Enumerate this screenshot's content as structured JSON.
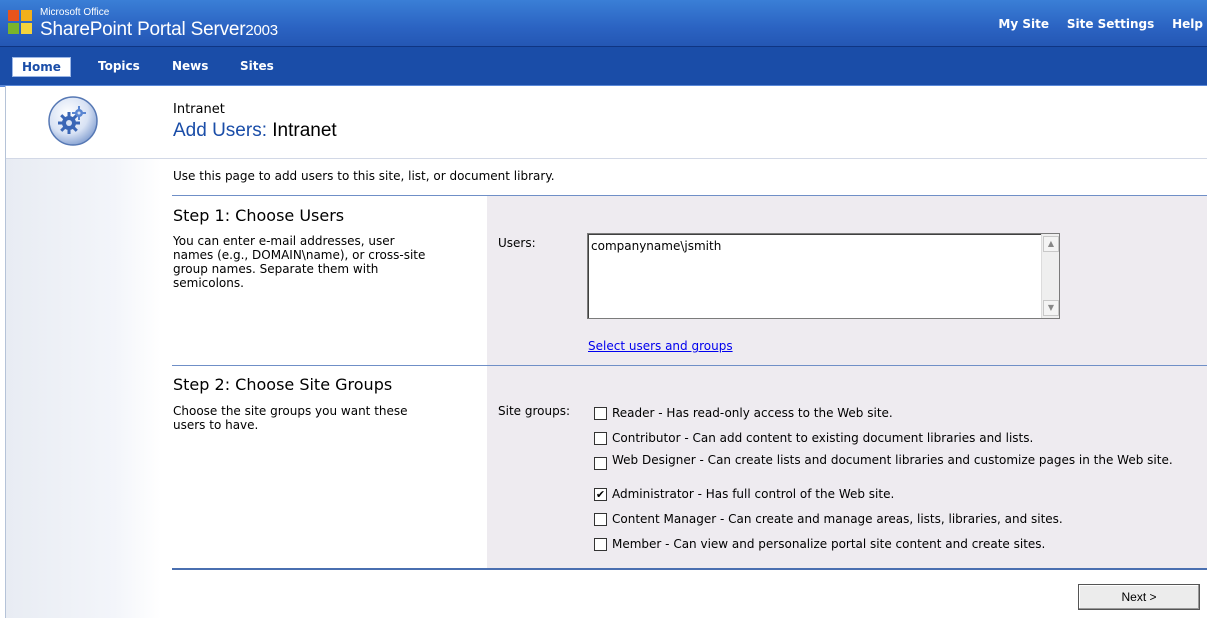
{
  "brand": {
    "line1": "Microsoft Office",
    "product": "SharePoint Portal Server",
    "year": "2003"
  },
  "toplinks": [
    "My Site",
    "Site Settings",
    "Help"
  ],
  "nav": [
    "Home",
    "Topics",
    "News",
    "Sites"
  ],
  "page": {
    "breadcrumb": "Intranet",
    "title_prefix": "Add Users:",
    "title_site": "Intranet",
    "intro": "Use this page to add users to this site, list, or document library."
  },
  "step1": {
    "title": "Step 1: Choose Users",
    "desc": [
      "You can enter e-mail addresses, user",
      "names (e.g., DOMAIN\\name), or cross-site",
      "group names. Separate them with",
      "semicolons."
    ],
    "users_label": "Users:",
    "users_value": "companyname\\jsmith",
    "select_link": "Select users and groups"
  },
  "step2": {
    "title": "Step 2: Choose Site Groups",
    "desc": [
      "Choose the site groups you want these",
      "users to have."
    ],
    "groups_label": "Site groups:",
    "groups": [
      {
        "text": "Reader - Has read-only access to the Web site.",
        "checked": false
      },
      {
        "text": "Contributor - Can add content to existing document libraries and lists.",
        "checked": false
      },
      {
        "text": "Web Designer - Can create lists and document libraries and customize pages in the Web site.",
        "checked": false
      },
      {
        "text": "Administrator - Has full control of the Web site.",
        "checked": true
      },
      {
        "text": "Content Manager - Can create and manage areas, lists, libraries, and sites.",
        "checked": false
      },
      {
        "text": "Member - Can view and personalize portal site content and create sites.",
        "checked": false
      }
    ]
  },
  "next_label": "Next >"
}
